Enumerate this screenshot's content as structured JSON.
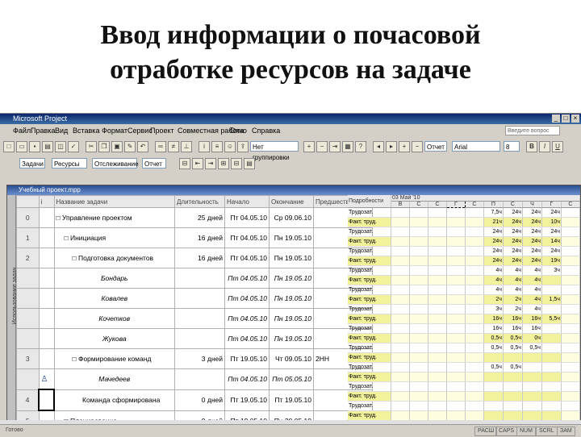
{
  "slide": {
    "title_line1": "Ввод информации о почасовой",
    "title_line2": "отработке ресурсов на задаче"
  },
  "app": {
    "window_title": "Microsoft Project",
    "menu": [
      "Файл",
      "Правка",
      "Вид",
      "Вставка",
      "Формат",
      "Сервис",
      "Проект",
      "Совместная работа",
      "Окно",
      "Справка"
    ],
    "search_placeholder": "Введите вопрос",
    "toolbar": {
      "group_label": "Нет группировки",
      "font": "Arial",
      "font_size": "8",
      "tasks_combo": "Задачи",
      "resources_combo": "Ресурсы",
      "track_combo": "Отслеживание",
      "report_combo": "Отчет"
    }
  },
  "document": {
    "title": "Учебный проект.mpp",
    "side_label": "Использование задач",
    "columns": {
      "indicator": "i",
      "name": "Название задачи",
      "duration": "Длительность",
      "start": "Начало",
      "finish": "Окончание",
      "predecessors": "Предшественники"
    },
    "rows": [
      {
        "id": "0",
        "name": "□ Управление проектом",
        "duration": "25 дней",
        "start": "Пт 04.05.10",
        "finish": "Ср 09.06.10",
        "pred": ""
      },
      {
        "id": "1",
        "name": "□ Инициация",
        "duration": "16 дней",
        "start": "Пт 04.05.10",
        "finish": "Пн 19.05.10",
        "pred": ""
      },
      {
        "id": "2",
        "name": "□ Подготовка документов",
        "duration": "16 дней",
        "start": "Пт 04.05.10",
        "finish": "Пн 19.05.10",
        "pred": ""
      },
      {
        "id": "",
        "name": "Бондарь",
        "duration": "",
        "start": "Пт 04.05.10",
        "finish": "Пн 19.05.10",
        "pred": ""
      },
      {
        "id": "",
        "name": "Ковалев",
        "duration": "",
        "start": "Пт 04.05.10",
        "finish": "Пн 19.05.10",
        "pred": ""
      },
      {
        "id": "",
        "name": "Кочетков",
        "duration": "",
        "start": "Пт 04.05.10",
        "finish": "Пн 19.05.10",
        "pred": ""
      },
      {
        "id": "",
        "name": "Жукова",
        "duration": "",
        "start": "Пт 04.05.10",
        "finish": "Пн 19.05.10",
        "pred": ""
      },
      {
        "id": "3",
        "name": "□ Формирование команд",
        "duration": "3 дней",
        "start": "Пт 19.05.10",
        "finish": "Чт 09.05.10",
        "pred": "2НН"
      },
      {
        "id": "",
        "name": "Мачедеев",
        "duration": "",
        "start": "Пт 04.05.10",
        "finish": "Пт 05.05.10",
        "pred": ""
      },
      {
        "id": "4",
        "name": "Команда сформирована",
        "duration": "0 дней",
        "start": "Пт 19.05.10",
        "finish": "Пт 19.05.10",
        "pred": ""
      },
      {
        "id": "5",
        "name": "□ Планирование",
        "duration": "9 дней",
        "start": "Пт 19.05.10",
        "finish": "Пн 30.05.10",
        "pred": ""
      }
    ],
    "usage": {
      "details_header": "Подробности",
      "week_label": "03 Май '10",
      "day_headers": [
        "В",
        "С",
        "С",
        "Г",
        "С",
        "П",
        "С",
        "Ч",
        "Г",
        "С"
      ],
      "detail_labels": [
        "Трудозат.",
        "Факт. труд."
      ],
      "rows": [
        {
          "plan": [
            "",
            "",
            "",
            "",
            "",
            "7,5ч",
            "24ч",
            "24ч",
            "24ч",
            ""
          ],
          "fact": [
            "",
            "",
            "",
            "",
            "",
            "21ч",
            "24ч",
            "24ч",
            "10ч",
            ""
          ]
        },
        {
          "plan": [
            "",
            "",
            "",
            "",
            "",
            "24ч",
            "24ч",
            "24ч",
            "24ч",
            ""
          ],
          "fact": [
            "",
            "",
            "",
            "",
            "",
            "24ч",
            "24ч",
            "24ч",
            "14ч",
            ""
          ]
        },
        {
          "plan": [
            "",
            "",
            "",
            "",
            "",
            "24ч",
            "24ч",
            "24ч",
            "24ч",
            ""
          ],
          "fact": [
            "",
            "",
            "",
            "",
            "",
            "24ч",
            "24ч",
            "24ч",
            "19ч",
            ""
          ]
        },
        {
          "plan": [
            "",
            "",
            "",
            "",
            "",
            "4ч",
            "4ч",
            "4ч",
            "3ч",
            ""
          ],
          "fact": [
            "",
            "",
            "",
            "",
            "",
            "4ч",
            "4ч",
            "4ч",
            "",
            ""
          ]
        },
        {
          "plan": [
            "",
            "",
            "",
            "",
            "",
            "4ч",
            "4ч",
            "4ч",
            "",
            ""
          ],
          "fact": [
            "",
            "",
            "",
            "",
            "",
            "2ч",
            "2ч",
            "4ч",
            "1,5ч",
            ""
          ]
        },
        {
          "plan": [
            "",
            "",
            "",
            "",
            "",
            "3ч",
            "2ч",
            "4ч",
            "",
            ""
          ],
          "fact": [
            "",
            "",
            "",
            "",
            "",
            "16ч",
            "16ч",
            "16ч",
            "5,5ч",
            ""
          ]
        },
        {
          "plan": [
            "",
            "",
            "",
            "",
            "",
            "16ч",
            "16ч",
            "16ч",
            "",
            ""
          ],
          "fact": [
            "",
            "",
            "",
            "",
            "",
            "0,5ч",
            "0,5ч",
            "0ч",
            "",
            ""
          ]
        },
        {
          "plan": [
            "",
            "",
            "",
            "",
            "",
            "0,5ч",
            "0,5ч",
            "0,5ч",
            "",
            ""
          ],
          "fact": [
            "",
            "",
            "",
            "",
            "",
            "",
            "",
            "",
            "",
            ""
          ]
        },
        {
          "plan": [
            "",
            "",
            "",
            "",
            "",
            "0,5ч",
            "0,5ч",
            "",
            "",
            ""
          ],
          "fact": [
            "",
            "",
            "",
            "",
            "",
            "",
            "",
            "",
            "",
            ""
          ]
        },
        {
          "plan": [
            "",
            "",
            "",
            "",
            "",
            "",
            "",
            "",
            "",
            ""
          ],
          "fact": [
            "",
            "",
            "",
            "",
            "",
            "",
            "",
            "",
            "",
            ""
          ]
        },
        {
          "plan": [
            "",
            "",
            "",
            "",
            "",
            "",
            "",
            "",
            "",
            ""
          ],
          "fact": [
            "",
            "",
            "",
            "",
            "",
            "",
            "",
            "",
            "",
            ""
          ]
        }
      ]
    }
  },
  "statusbar": {
    "mode": "Готово",
    "indicators": [
      "РАСШ",
      "CAPS",
      "NUM",
      "SCRL",
      "ЗАМ"
    ]
  }
}
